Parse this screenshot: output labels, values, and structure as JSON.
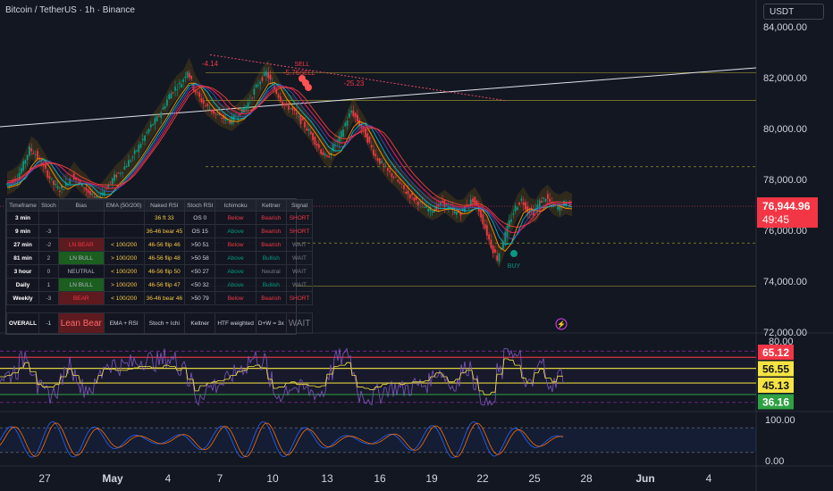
{
  "header": {
    "title": "Bitcoin / TetherUS · 1h · Binance",
    "currency": "USDT"
  },
  "colors": {
    "up": "#089981",
    "down": "#f23645",
    "bg": "#131722",
    "grid": "#1e222d",
    "rsi": "#7e57c2",
    "stoch_k": "#2962ff",
    "stoch_d": "#ff6d00"
  },
  "chart_data": [
    {
      "type": "line",
      "panel": "price",
      "series": [],
      "path_y": [
        77800,
        77900,
        78100,
        78600,
        79200,
        79000,
        78600,
        78200,
        77800,
        77600,
        77800,
        78200,
        77900,
        77700,
        77400,
        77200,
        77500,
        77800,
        78100,
        78300,
        78600,
        78900,
        79300,
        79700,
        80100,
        80400,
        80800,
        81300,
        81600,
        81800,
        82300,
        81600,
        81200,
        80900,
        80700,
        80500,
        80400,
        80300,
        80500,
        80700,
        81000,
        81500,
        81900,
        82200,
        81700,
        81300,
        80900,
        80800,
        80500,
        80200,
        79900,
        79500,
        79100,
        78800,
        79300,
        79600,
        80200,
        80700,
        80300,
        79900,
        79400,
        78900,
        78600,
        78300,
        78100,
        77800,
        77500,
        77300,
        77100,
        76900,
        76800,
        76900,
        77100,
        76900,
        76700,
        76700,
        77000,
        77200,
        76800,
        76100,
        75400,
        74900,
        75600,
        76300,
        76900,
        77200,
        76800,
        76700,
        77100,
        77300,
        77000,
        76900,
        77050,
        76944.96
      ],
      "y_axis": {
        "ticks": [
          "84,000.00",
          "82,000.00",
          "80,000.00",
          "78,000.00",
          "76,000.00",
          "74,000.00",
          "72,000.00"
        ],
        "min": 72000,
        "max": 84000
      },
      "x_axis": {
        "ticks": [
          "27",
          "May",
          "4",
          "7",
          "10",
          "13",
          "16",
          "19",
          "22",
          "25",
          "28",
          "Jun",
          "4"
        ]
      },
      "last_price": "76,944.96",
      "countdown": "49:45",
      "annotations": [
        "-4.14",
        "-5.76",
        "SELL",
        "SELL",
        "-25.23",
        "BUY"
      ],
      "levels": [
        82200,
        81100,
        78500,
        75500,
        73800
      ]
    },
    {
      "type": "line",
      "panel": "rsi",
      "series": [],
      "y_axis": {
        "ticks": [
          "80.00"
        ],
        "min": 25,
        "max": 82
      },
      "badges": [
        {
          "label": "65.12",
          "value": 65.12,
          "color": "#f23645"
        },
        {
          "label": "56.55",
          "value": 56.55,
          "color": "#f5e342"
        },
        {
          "label": "45.13",
          "value": 45.13,
          "color": "#f5e342"
        },
        {
          "label": "36.16",
          "value": 36.16,
          "color": "#2ea043"
        }
      ]
    },
    {
      "type": "line",
      "panel": "stoch",
      "series": [],
      "y_axis": {
        "ticks": [
          "100.00",
          "0.00"
        ],
        "min": 0,
        "max": 100
      }
    }
  ],
  "table": {
    "headers": [
      "Timeframe",
      "Stoch",
      "Bias",
      "EMA (50/200)",
      "Naked RSI",
      "Stoch RSI",
      "Ichimoku",
      "Keltner",
      "Signal"
    ],
    "rows": [
      {
        "tf": "3 min",
        "score": "",
        "bias": "",
        "ema": "",
        "rsi": "36 ft 33",
        "stoch": "OS 0",
        "ichi": "Below",
        "kelt": "Bearish",
        "sig": "SHORT"
      },
      {
        "tf": "9 min",
        "score": "-3",
        "bias": "",
        "ema": "",
        "rsi": "36-46 bear 45",
        "stoch": "OS 15",
        "ichi": "Above",
        "kelt": "Bearish",
        "sig": "SHORT"
      },
      {
        "tf": "27 min",
        "score": "-2",
        "bias": "LN BEAR",
        "ema": "< 100/200",
        "rsi": "46-56 flip 46",
        "stoch": ">50 51",
        "ichi": "Below",
        "kelt": "Bearish",
        "sig": "WAIT"
      },
      {
        "tf": "81 min",
        "score": "2",
        "bias": "LN BULL",
        "ema": "> 100/200",
        "rsi": "46-56 flip 48",
        "stoch": ">50 58",
        "ichi": "Above",
        "kelt": "Bullish",
        "sig": "WAIT"
      },
      {
        "tf": "3 hour",
        "score": "0",
        "bias": "NEUTRAL",
        "ema": "< 100/200",
        "rsi": "46-56 flip 50",
        "stoch": "<50 27",
        "ichi": "Above",
        "kelt": "Neutral",
        "sig": "WAIT"
      },
      {
        "tf": "Daily",
        "score": "1",
        "bias": "LN BULL",
        "ema": "> 100/200",
        "rsi": "46-56 flip 47",
        "stoch": "<50 32",
        "ichi": "Above",
        "kelt": "Bullish",
        "sig": "WAIT"
      },
      {
        "tf": "Weekly",
        "score": "-3",
        "bias": "BEAR",
        "ema": "< 100/200",
        "rsi": "36-46 bear 46",
        "stoch": ">50 79",
        "ichi": "Below",
        "kelt": "Bearish",
        "sig": "SHORT"
      }
    ],
    "overall": {
      "label": "OVERALL",
      "score": "-1",
      "bias": "Lean Bear",
      "ema": "EMA + RSI",
      "stoch": "Stoch + Ichi",
      "kelt": "Keltner",
      "htf": "HTF weighted",
      "dw": "D+W = 3x",
      "sig": "WAIT"
    }
  }
}
